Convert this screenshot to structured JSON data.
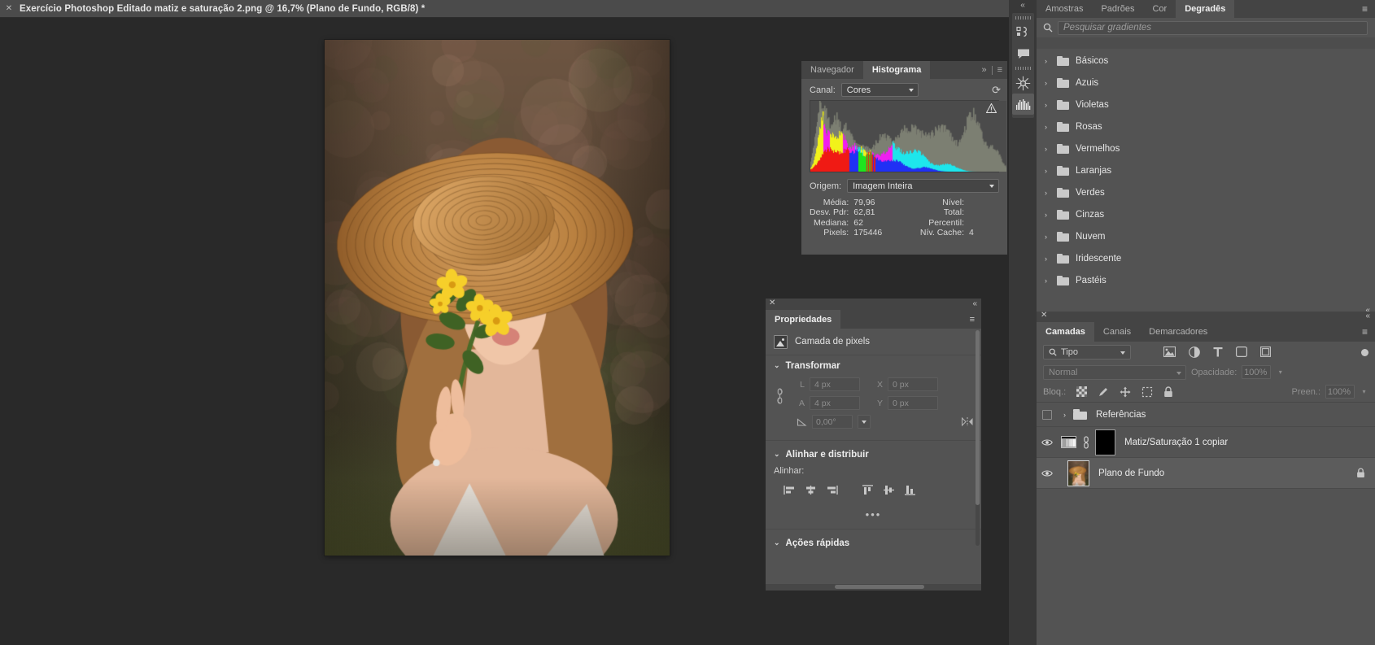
{
  "document": {
    "title": "Exercício Photoshop Editado matiz e saturação 2.png @ 16,7% (Plano de Fundo, RGB/8) *",
    "close_label": "✕"
  },
  "histogram_panel": {
    "tabs": [
      {
        "label": "Navegador",
        "active": false
      },
      {
        "label": "Histograma",
        "active": true
      }
    ],
    "expand_icon": "»",
    "menu_icon": "≡",
    "channel_label": "Canal:",
    "channel_value": "Cores",
    "refresh_icon": "⟳",
    "warning_icon": "warning-triangle",
    "origin_label": "Origem:",
    "origin_value": "Imagem Inteira",
    "stats_left": [
      {
        "key": "Média:",
        "value": "79,96"
      },
      {
        "key": "Desv. Pdr:",
        "value": "62,81"
      },
      {
        "key": "Mediana:",
        "value": "62"
      },
      {
        "key": "Pixels:",
        "value": "175446"
      }
    ],
    "stats_right": [
      {
        "key": "Nível:",
        "value": ""
      },
      {
        "key": "Total:",
        "value": ""
      },
      {
        "key": "Percentil:",
        "value": ""
      },
      {
        "key": "Nív. Cache:",
        "value": "4"
      }
    ]
  },
  "properties_panel": {
    "close_label": "✕",
    "collapse_label": "«",
    "tab_label": "Propriedades",
    "menu_icon": "≡",
    "header_label": "Camada de pixels",
    "sections": {
      "transform": {
        "title": "Transformar",
        "chevron": "⌄",
        "fields": [
          {
            "label": "L",
            "value": "4 px"
          },
          {
            "label": "X",
            "value": "0 px"
          },
          {
            "label": "A",
            "value": "4 px"
          },
          {
            "label": "Y",
            "value": "0 px"
          }
        ],
        "angle_value": "0,00°",
        "link_icon": "link-icon"
      },
      "align": {
        "title": "Alinhar e distribuir",
        "chevron": "⌄",
        "subtitle": "Alinhar:",
        "buttons": [
          "align-left-icon",
          "align-center-horizontal-icon",
          "align-right-icon",
          "align-top-icon",
          "align-center-vertical-icon",
          "align-bottom-icon"
        ],
        "more": "•••"
      },
      "quick_actions": {
        "title": "Ações rápidas",
        "chevron": "⌄"
      }
    }
  },
  "right_rail": {
    "collapse_icon": "«",
    "buttons": [
      {
        "name": "libraries-icon",
        "selected": false
      },
      {
        "name": "comments-icon",
        "selected": false
      },
      {
        "name": "adjustments-icon",
        "selected": false
      },
      {
        "name": "histogram-icon",
        "selected": true
      }
    ]
  },
  "gradients_panel": {
    "tabs": [
      {
        "label": "Amostras",
        "active": false
      },
      {
        "label": "Padrões",
        "active": false
      },
      {
        "label": "Cor",
        "active": false
      },
      {
        "label": "Degradês",
        "active": true
      }
    ],
    "menu_icon": "≡",
    "search_placeholder": "Pesquisar gradientes",
    "search_value": "",
    "search_icon": "search-icon",
    "collapse_icon": "«",
    "groups": [
      "Básicos",
      "Azuis",
      "Violetas",
      "Rosas",
      "Vermelhos",
      "Laranjas",
      "Verdes",
      "Cinzas",
      "Nuvem",
      "Iridescente",
      "Pastéis"
    ]
  },
  "layers_panel": {
    "close_label": "✕",
    "collapse_label": "«",
    "tabs": [
      {
        "label": "Camadas",
        "active": true
      },
      {
        "label": "Canais",
        "active": false
      },
      {
        "label": "Demarcadores",
        "active": false
      }
    ],
    "menu_icon": "≡",
    "filter_value": "Tipo",
    "filter_icons": [
      "pixel-filter-icon",
      "adjustment-filter-icon",
      "type-filter-icon",
      "shape-filter-icon",
      "smart-object-filter-icon"
    ],
    "filter_toggle": "filter-toggle",
    "blend_mode": "Normal",
    "opacity_label": "Opacidade:",
    "opacity_value": "100%",
    "lock_label": "Bloq.:",
    "lock_icons": [
      "lock-transparency-icon",
      "lock-pixels-icon",
      "lock-position-icon",
      "lock-artboard-icon",
      "lock-all-icon"
    ],
    "fill_label": "Preen.:",
    "fill_value": "100%",
    "layers": [
      {
        "type": "group",
        "name": "Referências",
        "visible": false,
        "expanded": false,
        "selected": false,
        "locked": false
      },
      {
        "type": "adjustment",
        "name": "Matiz/Saturação 1 copiar",
        "visible": true,
        "selected": false,
        "locked": false,
        "has_mask": true
      },
      {
        "type": "pixel",
        "name": "Plano de Fundo",
        "visible": true,
        "selected": true,
        "locked": true
      }
    ]
  }
}
